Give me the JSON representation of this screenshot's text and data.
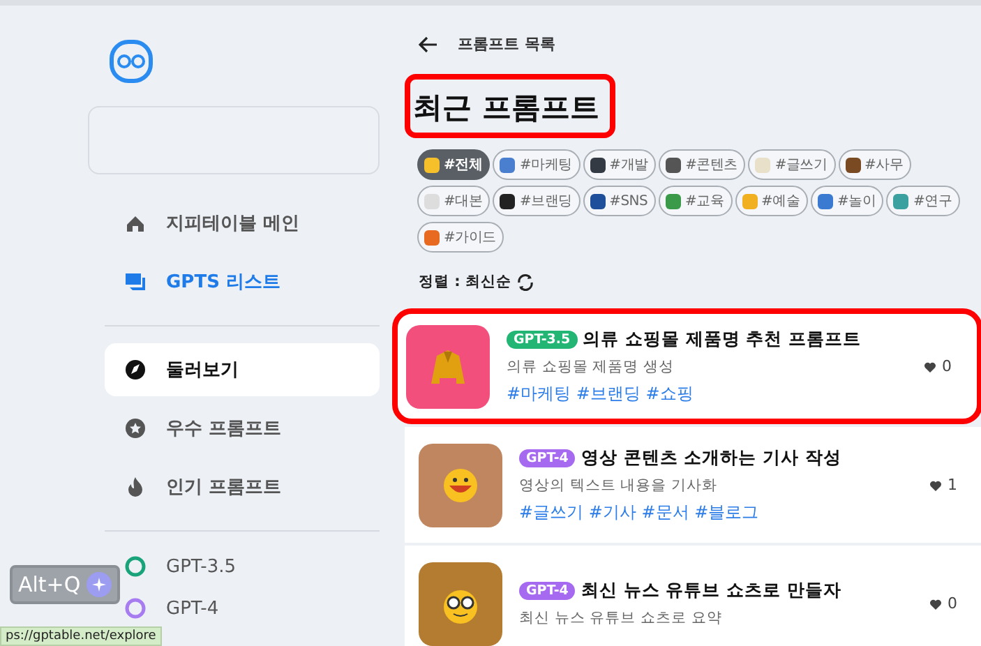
{
  "sidebar": {
    "items": [
      {
        "label": "지피테이블 메인",
        "kind": "home",
        "selected": false,
        "accent": false
      },
      {
        "label": "GPTS 리스트",
        "kind": "chat",
        "selected": false,
        "accent": true
      }
    ],
    "explore_items": [
      {
        "label": "둘러보기",
        "kind": "compass",
        "selected": true
      },
      {
        "label": "우수 프롬프트",
        "kind": "star",
        "selected": false
      },
      {
        "label": "인기 프롬프트",
        "kind": "fire",
        "selected": false
      }
    ],
    "models": [
      {
        "label": "GPT-3.5",
        "color": "#19a37a"
      },
      {
        "label": "GPT-4",
        "color": "#a77cf0"
      }
    ]
  },
  "header": {
    "back_label": "프롬프트 목록",
    "title": "최근 프롬프트",
    "title_highlighted": true
  },
  "tags": [
    {
      "label": "#전체",
      "selected": true,
      "color": "#f5c02a"
    },
    {
      "label": "#마케팅",
      "selected": false,
      "color": "#4a7fd0"
    },
    {
      "label": "#개발",
      "selected": false,
      "color": "#333a44"
    },
    {
      "label": "#콘텐츠",
      "selected": false,
      "color": "#555555"
    },
    {
      "label": "#글쓰기",
      "selected": false,
      "color": "#e8e0c8"
    },
    {
      "label": "#사무",
      "selected": false,
      "color": "#7a4a22"
    },
    {
      "label": "#대본",
      "selected": false,
      "color": "#dddddd"
    },
    {
      "label": "#브랜딩",
      "selected": false,
      "color": "#222222"
    },
    {
      "label": "#SNS",
      "selected": false,
      "color": "#1f4f9a"
    },
    {
      "label": "#교육",
      "selected": false,
      "color": "#3a9a4a"
    },
    {
      "label": "#예술",
      "selected": false,
      "color": "#f0b020"
    },
    {
      "label": "#놀이",
      "selected": false,
      "color": "#3a7ad0"
    },
    {
      "label": "#연구",
      "selected": false,
      "color": "#3aa0a0"
    },
    {
      "label": "#가이드",
      "selected": false,
      "color": "#e86a20"
    }
  ],
  "sort": {
    "label": "정렬 : 최신순"
  },
  "prompts": [
    {
      "model": {
        "label": "GPT-3.5",
        "color": "#22b573"
      },
      "title": "의류 쇼핑몰 제품명 추천 프롬프트",
      "description": "의류 쇼핑몰 제품명 생성",
      "tags": [
        "#마케팅",
        "#브랜딩",
        "#쇼핑"
      ],
      "likes": "0",
      "kind": "coat",
      "color": "#f34f7d",
      "highlighted": true
    },
    {
      "model": {
        "label": "GPT-4",
        "color": "#a66af0"
      },
      "title": "영상 콘텐츠 소개하는 기사 작성",
      "description": "영상의 텍스트 내용을 기사화",
      "tags": [
        "#글쓰기",
        "#기사",
        "#문서",
        "#블로그"
      ],
      "likes": "1",
      "kind": "smile",
      "color": "#c08660",
      "highlighted": false
    },
    {
      "model": {
        "label": "GPT-4",
        "color": "#a66af0"
      },
      "title": "최신 뉴스 유튜브 쇼츠로 만들자",
      "description": "최신 뉴스 유튜브 쇼츠로 요약",
      "likes": "0",
      "kind": "nerd",
      "color": "#b37c30",
      "highlighted": false
    }
  ],
  "overlay": {
    "shortcut": "Alt+Q",
    "status_url": "ps://gptable.net/explore"
  }
}
